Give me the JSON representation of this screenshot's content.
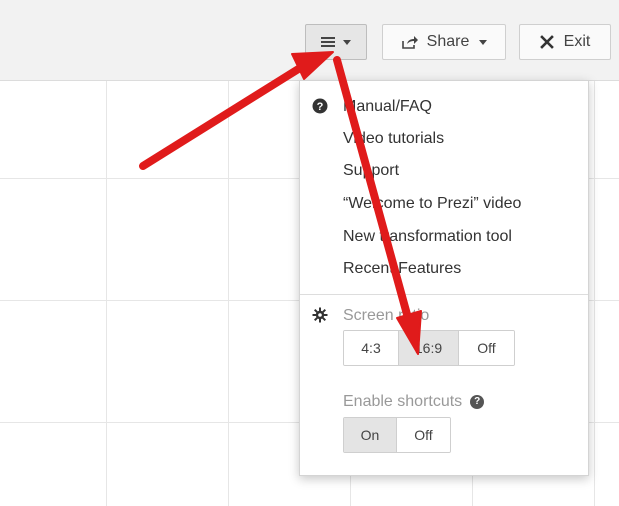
{
  "toolbar": {
    "share_label": "Share",
    "exit_label": "Exit",
    "menu_icon": "hamburger-icon"
  },
  "menu": {
    "help_items": [
      "Manual/FAQ",
      "Video tutorials",
      "Support",
      "“Welcome to Prezi” video",
      "New transformation tool",
      "Recent Features"
    ],
    "screen_ratio_label": "Screen ratio",
    "ratio_options": [
      "4:3",
      "16:9",
      "Off"
    ],
    "ratio_selected": "16:9",
    "shortcuts_label": "Enable shortcuts",
    "shortcut_options": [
      "On",
      "Off"
    ],
    "shortcut_selected": "On"
  },
  "colors": {
    "arrow": "#e01b1b",
    "toolbar_bg": "#f2f2f2"
  },
  "icons": [
    "hamburger-icon",
    "share-icon",
    "close-icon",
    "question-icon",
    "gear-icon"
  ]
}
